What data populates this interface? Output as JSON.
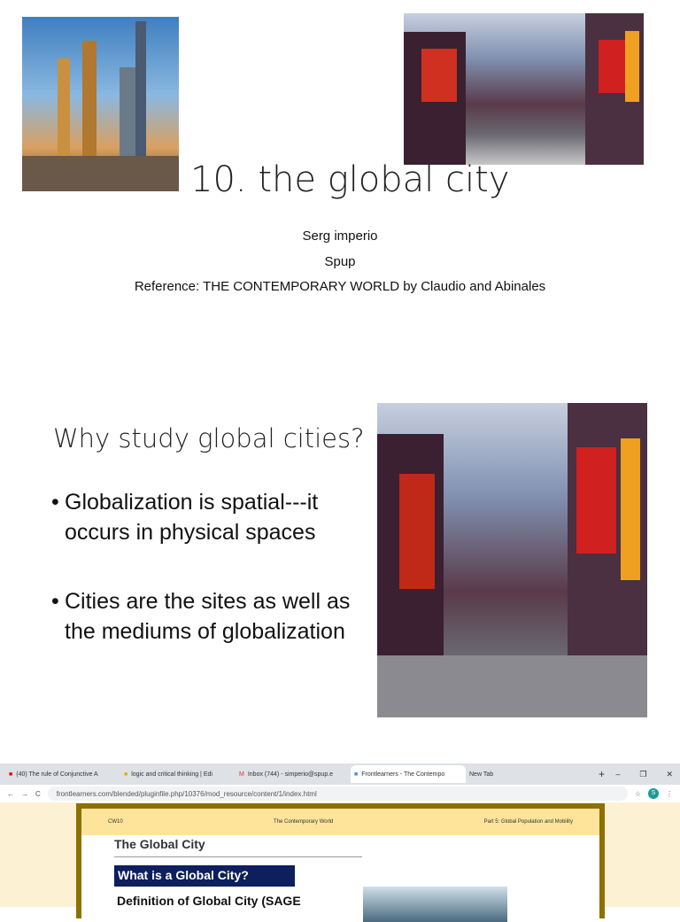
{
  "slide1": {
    "title": "10. the global city",
    "author": "Serg imperio",
    "institution": "Spup",
    "reference": "Reference: THE CONTEMPORARY WORLD by Claudio and Abinales"
  },
  "slide2": {
    "heading": "Why study global cities?",
    "bullets": [
      "Globalization is spatial---it occurs in physical spaces",
      "Cities are the sites as well as the mediums of globalization"
    ]
  },
  "browser": {
    "tabs": [
      "(40) The rule of Conjunctive A",
      "logic and critical thinking | Edi",
      "Inbox (744) - simperio@spup.e",
      "Frontlearners - The Contempo",
      "New Tab"
    ],
    "url": "frontlearners.com/blended/pluginfile.php/10376/mod_resource/content/1/index.html",
    "avatar": "S",
    "page": {
      "course": "CW10",
      "course_name": "The Contemporary World",
      "part": "Part 5: Global Population and Mobility",
      "title": "The Global City",
      "banner": "What is a Global City?",
      "definition": "Definition of Global City (SAGE"
    }
  }
}
